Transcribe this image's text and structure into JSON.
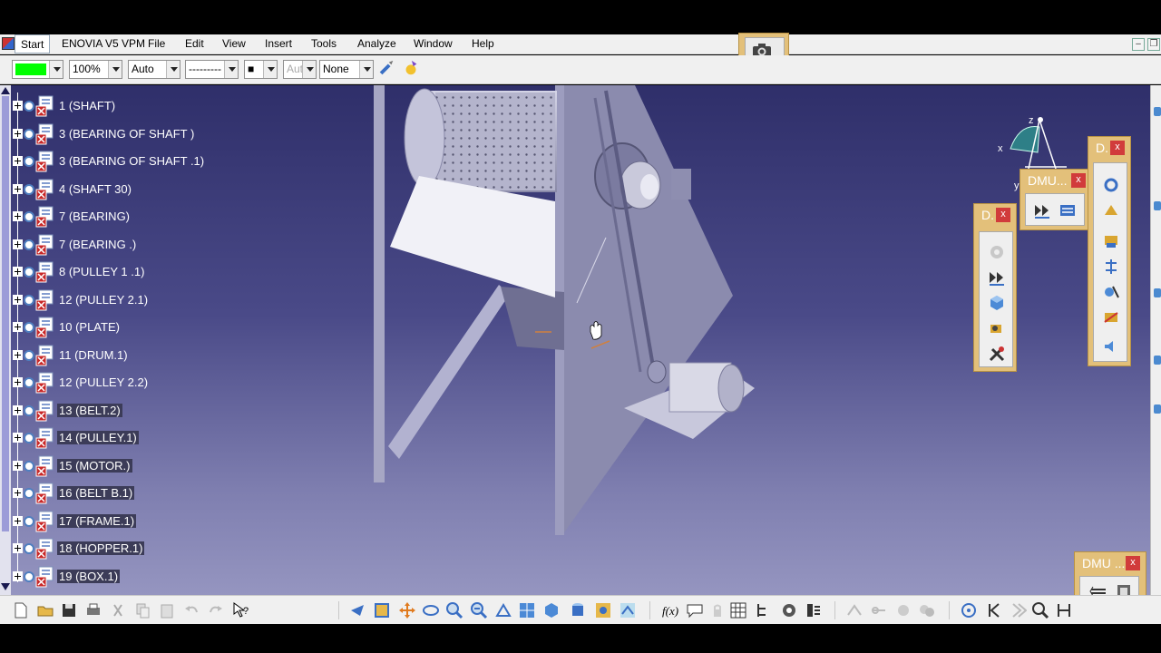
{
  "menubar": {
    "start": "Start",
    "items": [
      "ENOVIA V5 VPM",
      "File",
      "Edit",
      "View",
      "Insert",
      "Tools",
      "Analyze",
      "Window",
      "Help"
    ]
  },
  "properties_toolbar": {
    "color_swatch": "#00ff00",
    "transparency": "100%",
    "line_weight": "Auto",
    "line_type": "---------",
    "point_symbol": "■",
    "layer_disabled": "Aut",
    "layer": "None"
  },
  "tree": {
    "items": [
      {
        "label": "1 (SHAFT)",
        "selected": false
      },
      {
        "label": "3 (BEARING OF SHAFT )",
        "selected": false
      },
      {
        "label": "3 (BEARING OF SHAFT .1)",
        "selected": false
      },
      {
        "label": "4 (SHAFT 30)",
        "selected": false
      },
      {
        "label": "7 (BEARING)",
        "selected": false
      },
      {
        "label": "7 (BEARING .)",
        "selected": false
      },
      {
        "label": "8  (PULLEY 1 .1)",
        "selected": false
      },
      {
        "label": "12 (PULLEY 2.1)",
        "selected": false
      },
      {
        "label": "10 (PLATE)",
        "selected": false
      },
      {
        "label": "11 (DRUM.1)",
        "selected": false
      },
      {
        "label": "12 (PULLEY 2.2)",
        "selected": false
      },
      {
        "label": "13 (BELT.2)",
        "selected": true
      },
      {
        "label": "14 (PULLEY.1)",
        "selected": true
      },
      {
        "label": "15 (MOTOR.)",
        "selected": true
      },
      {
        "label": "16 (BELT B.1)",
        "selected": true
      },
      {
        "label": "17 (FRAME.1)",
        "selected": true
      },
      {
        "label": "18 (HOPPER.1)",
        "selected": true
      },
      {
        "label": "19 (BOX.1)",
        "selected": true
      }
    ]
  },
  "floating_toolbars": {
    "dmu_a": "D.",
    "dmu_b": "DMU...",
    "dmu_c": "D.",
    "dmu_d": "DMU ...",
    "close": "x"
  },
  "compass": {
    "x": "x",
    "y": "y",
    "z": "z"
  },
  "colors": {
    "accent": "#e3c07a",
    "close_red": "#d13b3b",
    "viewport_top": "#2f2f6a",
    "viewport_bottom": "#9595c0"
  }
}
